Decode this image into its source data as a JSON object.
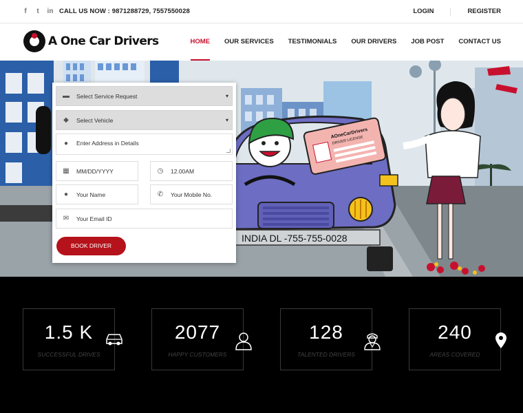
{
  "topbar": {
    "social": [
      "f",
      "t",
      "in"
    ],
    "phone": "CALL US NOW : 9871288729, 7557550028",
    "login": "LOGIN",
    "register": "REGISTER"
  },
  "brand": {
    "name": "A One Car Drivers"
  },
  "nav": {
    "items": [
      {
        "label": "HOME"
      },
      {
        "label": "OUR SERVICES"
      },
      {
        "label": "TESTIMONIALS"
      },
      {
        "label": "OUR DRIVERS"
      },
      {
        "label": "JOB POST"
      },
      {
        "label": "CONTACT US"
      }
    ],
    "active": "HOME"
  },
  "hero": {
    "plate": "INDIA DL -755-755-0028",
    "card_title": "AOneCarDrivers",
    "card_sub": "DRIVER LICENSE"
  },
  "form": {
    "service": "Select Service Request",
    "vehicle": "Select Vehicle",
    "address": "Enter Address in Details",
    "date": "MM/DD/YYYY",
    "time": "12.00AM",
    "name": "Your Name",
    "mobile": "Your Mobile No.",
    "email": "Your Email ID",
    "submit": "BOOK DRIVER"
  },
  "stats": [
    {
      "value": "1.5 K",
      "label": "SUCCESSFUL DRIVES",
      "icon": "car-icon"
    },
    {
      "value": "2077",
      "label": "HAPPY CUSTOMERS",
      "icon": "user-icon"
    },
    {
      "value": "128",
      "label": "TALENTED DRIVERS",
      "icon": "driver-icon"
    },
    {
      "value": "240",
      "label": "AREAS COVERED",
      "icon": "location-pin-icon"
    }
  ],
  "colors": {
    "accent": "#c8102e",
    "button": "#b5121b",
    "stats_bg": "#000000"
  }
}
